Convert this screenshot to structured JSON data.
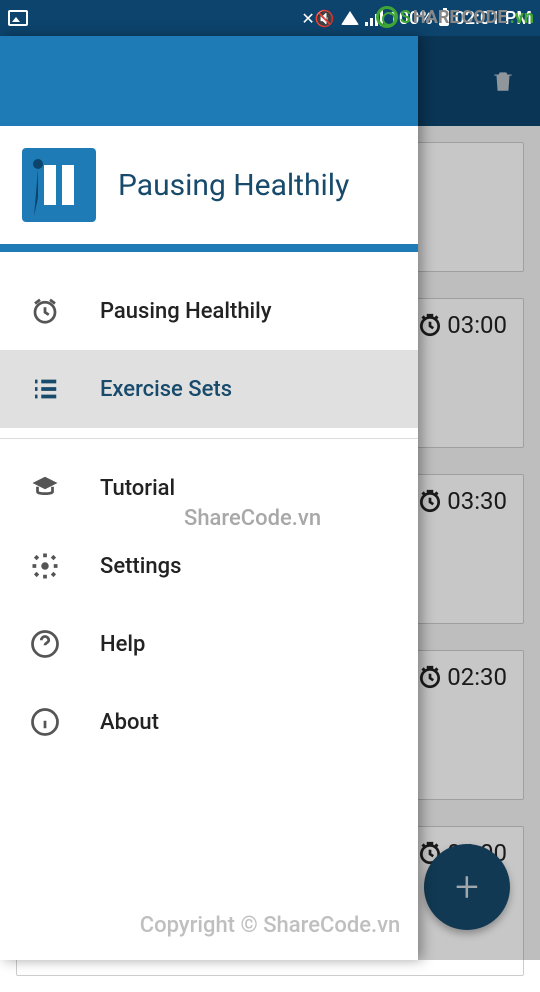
{
  "status_bar": {
    "battery_text": "100%",
    "time": "02:01 PM"
  },
  "appbar": {
    "delete_label": "Delete"
  },
  "drawer": {
    "app_name": "Pausing Healthily",
    "items": [
      {
        "icon": "alarm-icon",
        "label": "Pausing Healthily",
        "selected": false
      },
      {
        "icon": "list-icon",
        "label": "Exercise Sets",
        "selected": true
      },
      {
        "icon": "tutorial-icon",
        "label": "Tutorial",
        "selected": false
      },
      {
        "icon": "gear-icon",
        "label": "Settings",
        "selected": false
      },
      {
        "icon": "help-icon",
        "label": "Help",
        "selected": false
      },
      {
        "icon": "info-icon",
        "label": "About",
        "selected": false
      }
    ]
  },
  "exercise_sets": [
    {
      "duration": ""
    },
    {
      "duration": "03:00"
    },
    {
      "duration": "03:30"
    },
    {
      "duration": "02:30"
    },
    {
      "duration": "04:00"
    }
  ],
  "fab": {
    "label": "+"
  },
  "watermarks": {
    "top_brand_1": "S",
    "top_brand_2": "HARE",
    "top_brand_3": "CODE",
    "top_brand_4": ".vn",
    "mid": "ShareCode.vn",
    "bottom": "Copyright © ShareCode.vn"
  }
}
